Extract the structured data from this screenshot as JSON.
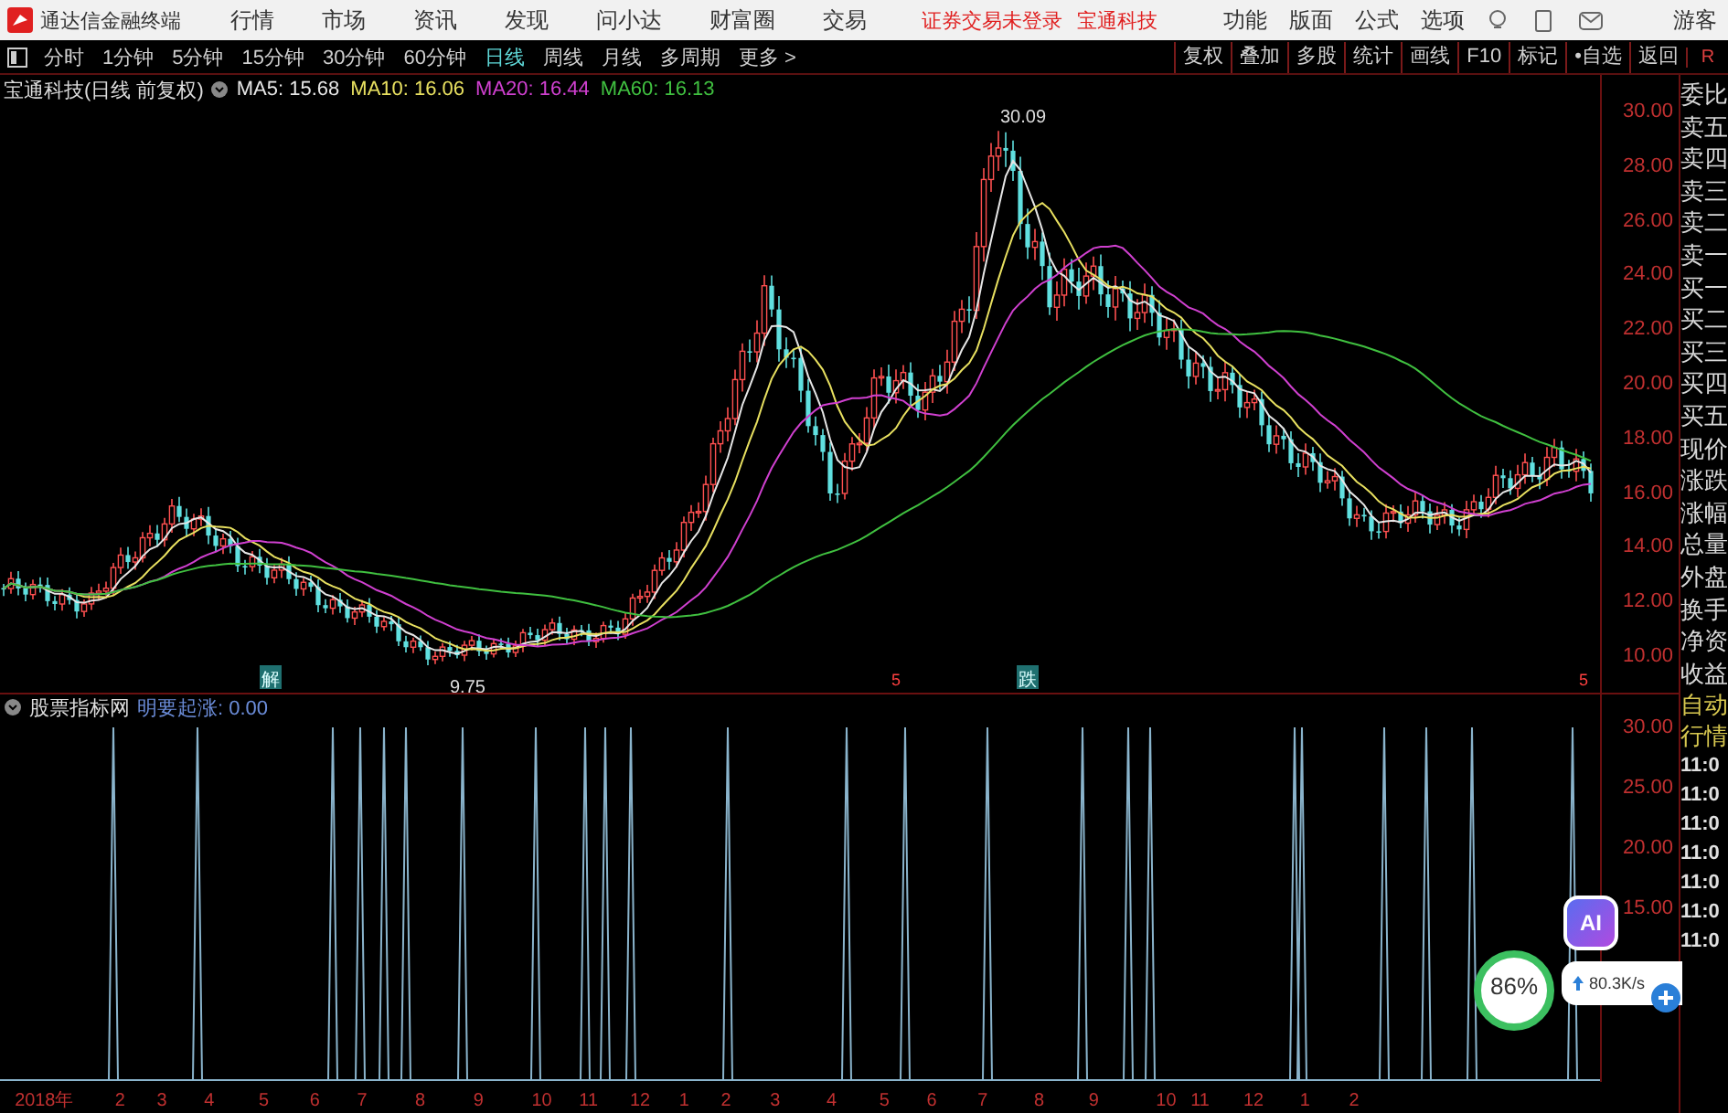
{
  "app_bar": {
    "title": "通达信金融终端",
    "menus": [
      "行情",
      "市场",
      "资讯",
      "发现",
      "问小达",
      "财富圈",
      "交易"
    ],
    "notice": "证券交易未登录",
    "stock_link": "宝通科技",
    "actions": [
      "功能",
      "版面",
      "公式",
      "选项"
    ],
    "user": "游客"
  },
  "period_tabs": [
    {
      "label": "分时",
      "selected": false
    },
    {
      "label": "1分钟",
      "selected": false
    },
    {
      "label": "5分钟",
      "selected": false
    },
    {
      "label": "15分钟",
      "selected": false
    },
    {
      "label": "30分钟",
      "selected": false
    },
    {
      "label": "60分钟",
      "selected": false
    },
    {
      "label": "日线",
      "selected": true
    },
    {
      "label": "周线",
      "selected": false
    },
    {
      "label": "月线",
      "selected": false
    },
    {
      "label": "多周期",
      "selected": false
    },
    {
      "label": "更多 >",
      "selected": false
    }
  ],
  "tools": [
    "复权",
    "叠加",
    "多股",
    "统计",
    "画线",
    "F10",
    "标记",
    "•自选",
    "返回"
  ],
  "chart_header": {
    "title": "宝通科技(日线 前复权)",
    "ma": [
      {
        "label": "MA5: 15.68",
        "color": "#e6e6e6"
      },
      {
        "label": "MA10: 16.06",
        "color": "#e8e060"
      },
      {
        "label": "MA20: 16.44",
        "color": "#d040d0"
      },
      {
        "label": "MA60: 16.13",
        "color": "#40c040"
      }
    ]
  },
  "price_axis": [
    "30.00",
    "28.00",
    "26.00",
    "24.00",
    "22.00",
    "20.00",
    "18.00",
    "16.00",
    "14.00",
    "12.00",
    "10.00"
  ],
  "high_label": "30.09",
  "low_label": "9.75",
  "markers": [
    {
      "label": "解",
      "kind": "box"
    },
    {
      "label": "5",
      "kind": "plain"
    },
    {
      "label": "跌",
      "kind": "box"
    },
    {
      "label": "5",
      "kind": "plain"
    }
  ],
  "indicator": {
    "name": "股票指标网",
    "formula": "明要起涨: 0.00"
  },
  "indicator_axis": [
    "30.00",
    "25.00",
    "20.00",
    "15.00"
  ],
  "time_axis": [
    "2018年",
    "2",
    "3",
    "4",
    "5",
    "6",
    "7",
    "8",
    "9",
    "10",
    "11",
    "12",
    "1",
    "2",
    "3",
    "4",
    "5",
    "6",
    "7",
    "8",
    "9",
    "10",
    "11",
    "12",
    "1",
    "2"
  ],
  "corner_label": "R",
  "side_labels": [
    "委比",
    "卖五",
    "卖四",
    "卖三",
    "卖二",
    "卖一",
    "买一",
    "买二",
    "买三",
    "买四",
    "买五",
    "现价",
    "涨跌",
    "涨幅",
    "总量",
    "外盘",
    "换手",
    "净资",
    "收益"
  ],
  "side_labels_2": [
    "自动",
    "行情",
    "11:0",
    "11:0",
    "11:0",
    "11:0",
    "11:0",
    "11:0",
    "11:0"
  ],
  "overlays": {
    "ai": "AI",
    "cpu": "86%",
    "net": "80.3K/s"
  }
}
